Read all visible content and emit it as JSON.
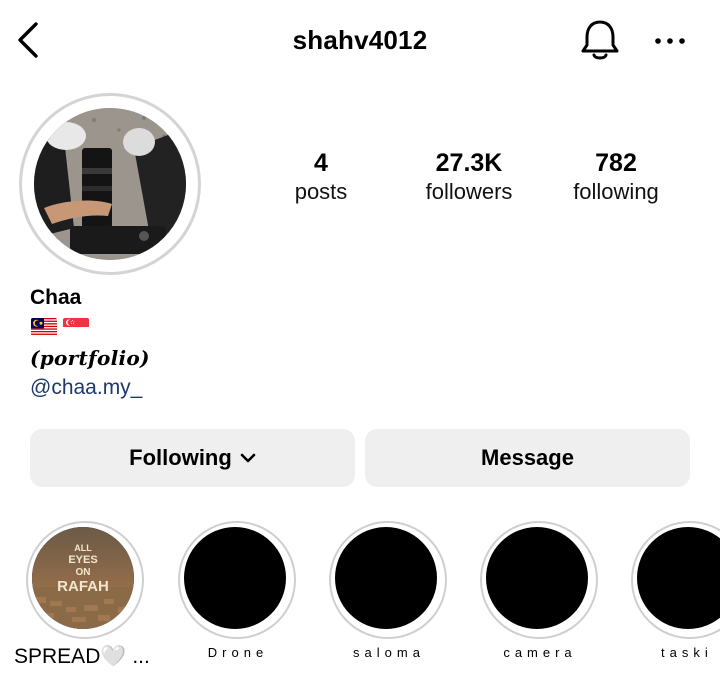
{
  "header": {
    "username": "shahv4012",
    "back_icon": "chevron-left-icon",
    "bell_icon": "bell-icon",
    "more_icon": "more-horizontal-icon"
  },
  "stats": {
    "posts": {
      "value": "4",
      "label": "posts"
    },
    "followers": {
      "value": "27.3K",
      "label": "followers"
    },
    "following": {
      "value": "782",
      "label": "following"
    }
  },
  "profile": {
    "name": "Chaa",
    "flags": [
      "🇲🇾",
      "🇸🇬"
    ],
    "bio": "(portfolio)",
    "link": "@chaa.my_"
  },
  "actions": {
    "following_label": "Following",
    "message_label": "Message"
  },
  "highlights": [
    {
      "caption": "SPREAD🤍 ...",
      "cover_text": "ALL EYES ON RAFAH"
    },
    {
      "caption": "Drone"
    },
    {
      "caption": "saloma"
    },
    {
      "caption": "camera"
    },
    {
      "caption": "taski"
    }
  ],
  "colors": {
    "button_bg": "#efefef",
    "link": "#1d3a6b",
    "ring": "#d4d4d4"
  }
}
